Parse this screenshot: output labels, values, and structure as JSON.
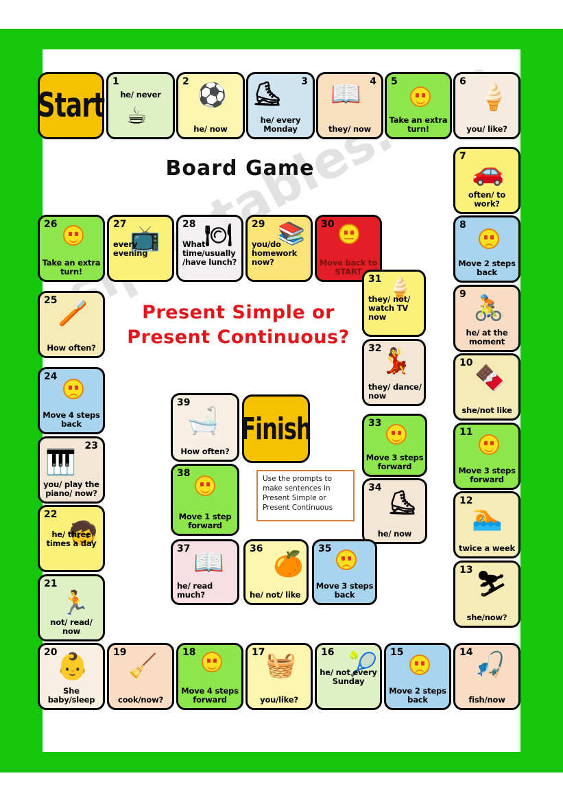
{
  "worksheet": {
    "heading": "Board Game",
    "title_line1": "Present Simple or",
    "title_line2": "Present Continuous?",
    "instruction": "Use the prompts to make sentences in Present Simple or Present Continuous",
    "watermark": "eslprintables.com",
    "start_label": "Start",
    "finish_label": "Finish",
    "colors": {
      "frame_green": "#16c60c",
      "start_finish_yellow": "#f5c100",
      "title_red": "#e3171b",
      "instruction_border": "#e07c28",
      "bonus_green": "#8ce64c",
      "penalty_blue": "#a8d4ee",
      "penalty_red": "#e21f26"
    }
  },
  "cells": [
    {
      "num": "1",
      "text": "he/ never",
      "bg": "#dff0c6",
      "icon": "cup-of-tea-icon",
      "glyph": "☕",
      "numpos": "tl",
      "textpos": "top"
    },
    {
      "num": "2",
      "text": "he/ now",
      "bg": "#fbf5b0",
      "icon": "boy-playing-soccer-icon",
      "glyph": "⚽",
      "numpos": "tl",
      "textpos": "bottom"
    },
    {
      "num": "3",
      "text": "he/ every Monday",
      "bg": "#cfe4f1",
      "icon": "ice-hockey-player-icon",
      "glyph": "⛸",
      "numpos": "tr",
      "textpos": "bottom"
    },
    {
      "num": "4",
      "text": "they/ now",
      "bg": "#f8dfc0",
      "icon": "family-reading-icon",
      "glyph": "📖",
      "numpos": "tr",
      "textpos": "bottom"
    },
    {
      "num": "5",
      "text": "Take an extra turn!",
      "bg": "#8ce64c",
      "icon": "happy-smiley-icon",
      "glyph": "smiley-happy",
      "numpos": "tl",
      "textpos": "bottom"
    },
    {
      "num": "6",
      "text": "you/ like?",
      "bg": "#f4ece0",
      "icon": "ice-cream-cone-icon",
      "glyph": "🍦",
      "numpos": "tl",
      "textpos": "bottom"
    },
    {
      "num": "7",
      "text": "often/ to work?",
      "bg": "#fbf07a",
      "icon": "car-driving-icon",
      "glyph": "🚗",
      "numpos": "tl",
      "textpos": "bottom"
    },
    {
      "num": "8",
      "text": "Move 2 steps back",
      "bg": "#a8d4ee",
      "icon": "sad-smiley-icon",
      "glyph": "smiley-sad",
      "numpos": "tl",
      "textpos": "bottom"
    },
    {
      "num": "9",
      "text": "he/ at the moment",
      "bg": "#f8ddc4",
      "icon": "boy-cycling-icon",
      "glyph": "🚴",
      "numpos": "tl",
      "textpos": "bottom"
    },
    {
      "num": "10",
      "text": "she/not like",
      "bg": "#f6ebb6",
      "icon": "chocolate-box-icon",
      "glyph": "🍫",
      "numpos": "tl",
      "textpos": "bottom"
    },
    {
      "num": "11",
      "text": "Move 3 steps forward",
      "bg": "#8ce64c",
      "icon": "happy-smiley-icon",
      "glyph": "smiley-happy",
      "numpos": "tl",
      "textpos": "bottom"
    },
    {
      "num": "12",
      "text": "twice a week",
      "bg": "#f6ebb6",
      "icon": "person-snorkeling-icon",
      "glyph": "🏊",
      "numpos": "tl",
      "textpos": "bottom"
    },
    {
      "num": "13",
      "text": "she/now?",
      "bg": "#f6ebb6",
      "icon": "skier-icon",
      "glyph": "⛷",
      "numpos": "tl",
      "textpos": "bottom"
    },
    {
      "num": "14",
      "text": "fish/now",
      "bg": "#f8ddc4",
      "icon": "fishing-icon",
      "glyph": "🎣",
      "numpos": "tl",
      "textpos": "bottom"
    },
    {
      "num": "15",
      "text": "Move 2 steps back",
      "bg": "#a8d4ee",
      "icon": "sad-smiley-icon",
      "glyph": "smiley-sad",
      "numpos": "tl",
      "textpos": "bottom"
    },
    {
      "num": "16",
      "text": "he/ not every Sunday",
      "bg": "#dff0c6",
      "icon": "tennis-racket-icon",
      "glyph": "🎾",
      "numpos": "tl",
      "textpos": "mid"
    },
    {
      "num": "17",
      "text": "you/like?",
      "bg": "#fbf5b0",
      "icon": "girl-with-basket-icon",
      "glyph": "🧺",
      "numpos": "tl",
      "textpos": "bottom"
    },
    {
      "num": "18",
      "text": "Move 4 steps forward",
      "bg": "#8ce64c",
      "icon": "happy-smiley-icon",
      "glyph": "smiley-happy",
      "numpos": "tl",
      "textpos": "bottom"
    },
    {
      "num": "19",
      "text": "cook/now?",
      "bg": "#f8ddc4",
      "icon": "vacuum-cleaner-icon",
      "glyph": "🧹",
      "numpos": "tl",
      "textpos": "bottom"
    },
    {
      "num": "20",
      "text": "She baby/sleep",
      "bg": "#f7f0e2",
      "icon": "sleeping-baby-icon",
      "glyph": "👶",
      "numpos": "tl",
      "textpos": "bottom"
    },
    {
      "num": "21",
      "text": "not/ read/ now",
      "bg": "#dff0c6",
      "icon": "boy-running-icon",
      "glyph": "🏃",
      "numpos": "tl",
      "textpos": "bottom"
    },
    {
      "num": "22",
      "text": "he/ three times a day",
      "bg": "#fbf07a",
      "icon": "boy-brushing-teeth-icon",
      "glyph": "🧒",
      "numpos": "tl",
      "textpos": "mid"
    },
    {
      "num": "23",
      "text": "you/ play the piano/ now?",
      "bg": "#f4e6d5",
      "icon": "woman-playing-piano-icon",
      "glyph": "🎹",
      "numpos": "tr",
      "textpos": "bottom"
    },
    {
      "num": "24",
      "text": "Move 4 steps back",
      "bg": "#a8d4ee",
      "icon": "sad-smiley-icon",
      "glyph": "smiley-sad",
      "numpos": "tl",
      "textpos": "bottom"
    },
    {
      "num": "25",
      "text": "How often?",
      "bg": "#f6ebb6",
      "icon": "brushing-teeth-icon",
      "glyph": "🪥",
      "numpos": "tl",
      "textpos": "bottom"
    },
    {
      "num": "26",
      "text": "Take an extra turn!",
      "bg": "#8ce64c",
      "icon": "happy-smiley-icon",
      "glyph": "smiley-happy",
      "numpos": "tl",
      "textpos": "bottom"
    },
    {
      "num": "27",
      "text": "every evening",
      "bg": "#fbf07a",
      "icon": "girl-watching-tv-icon",
      "glyph": "📺",
      "numpos": "tl",
      "textpos": "mid-left"
    },
    {
      "num": "28",
      "text": "What time/usually /have lunch?",
      "bg": "#f4f0f2",
      "icon": "baby-eating-icon",
      "glyph": "🍽",
      "numpos": "tl",
      "textpos": "mid-left"
    },
    {
      "num": "29",
      "text": "you/do homework now?",
      "bg": "#fbe477",
      "icon": "boy-doing-homework-icon",
      "glyph": "📚",
      "numpos": "tl",
      "textpos": "mid-left"
    },
    {
      "num": "30",
      "text": "Move back to START",
      "bg": "#e21f26",
      "icon": "sad-smiley-icon",
      "glyph": "smiley-flat",
      "numpos": "tl",
      "textpos": "bottom"
    },
    {
      "num": "31",
      "text": "they/ not/ watch TV now",
      "bg": "#fbf07a",
      "icon": "kids-with-ice-cream-icon",
      "glyph": "🍦",
      "numpos": "tl",
      "textpos": "mid-left"
    },
    {
      "num": "32",
      "text": "they/ dance/ now",
      "bg": "#f4e6d5",
      "icon": "dancing-couple-icon",
      "glyph": "💃",
      "numpos": "tl",
      "textpos": "bottom-left"
    },
    {
      "num": "33",
      "text": "Move 3 steps forward",
      "bg": "#8ce64c",
      "icon": "happy-smiley-icon",
      "glyph": "smiley-happy",
      "numpos": "tl",
      "textpos": "bottom"
    },
    {
      "num": "34",
      "text": "he/ now",
      "bg": "#f4e6d5",
      "icon": "boy-skating-icon",
      "glyph": "⛸",
      "numpos": "tl",
      "textpos": "bottom"
    },
    {
      "num": "35",
      "text": "Move 3 steps back",
      "bg": "#a8d4ee",
      "icon": "sad-smiley-icon",
      "glyph": "smiley-sad",
      "numpos": "tl",
      "textpos": "bottom"
    },
    {
      "num": "36",
      "text": "he/ not/ like",
      "bg": "#fbf5b0",
      "icon": "orange-fruit-icon",
      "glyph": "🍊",
      "numpos": "tl",
      "textpos": "bottom-left"
    },
    {
      "num": "37",
      "text": "he/ read much?",
      "bg": "#f7dfe4",
      "icon": "boy-reading-book-icon",
      "glyph": "📖",
      "numpos": "tl",
      "textpos": "bottom-left"
    },
    {
      "num": "38",
      "text": "Move 1 step forward",
      "bg": "#8ce64c",
      "icon": "happy-smiley-icon",
      "glyph": "smiley-happy",
      "numpos": "tl",
      "textpos": "bottom"
    },
    {
      "num": "39",
      "text": "How often?",
      "bg": "#f7f0e2",
      "icon": "baby-in-bathtub-icon",
      "glyph": "🛁",
      "numpos": "tl",
      "textpos": "bottom"
    }
  ]
}
